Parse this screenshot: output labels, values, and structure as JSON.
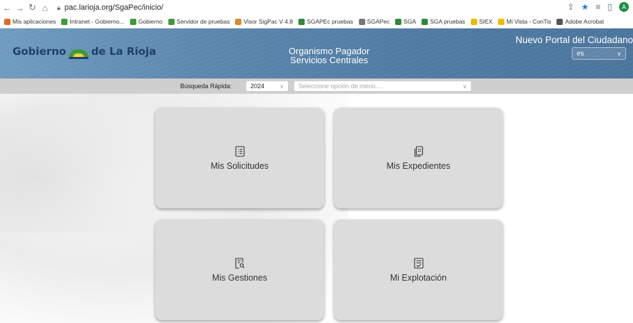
{
  "browser": {
    "url": "pac.larioja.org/SgaPec/inicio/",
    "profile_initial": "A"
  },
  "bookmarks": [
    {
      "label": "Mis aplicaciones",
      "color": "#e06a2a"
    },
    {
      "label": "Intranet - Gobierno...",
      "color": "#3f9a3a"
    },
    {
      "label": "Gobierno",
      "color": "#3f9a3a"
    },
    {
      "label": "Servidor de pruebas",
      "color": "#3f9a3a"
    },
    {
      "label": "Visor SigPac V 4.8",
      "color": "#d98a2b"
    },
    {
      "label": "SGAPEc pruebas",
      "color": "#2d8a3a"
    },
    {
      "label": "SGAPec",
      "color": "#777777"
    },
    {
      "label": "SGA",
      "color": "#2d8a3a"
    },
    {
      "label": "SGA pruebas",
      "color": "#2d8a3a"
    },
    {
      "label": "SIEX",
      "color": "#f2b705"
    },
    {
      "label": "Mi Vista - ConTis",
      "color": "#f2b705"
    },
    {
      "label": "Adobe Acrobat",
      "color": "#555555"
    }
  ],
  "header": {
    "logo_text_1": "Gobierno",
    "logo_text_2": "de La Rioja",
    "org_line1": "Organismo Pagador",
    "org_line2": "Servicios Centrales",
    "portal_title": "Nuevo Portal del Ciudadano",
    "language": "es"
  },
  "search": {
    "label": "Búsqueda Rápida:",
    "year": "2024",
    "menu_placeholder": "Seleccione opción de menú...."
  },
  "tiles": [
    {
      "label": "Mis Solicitudes",
      "icon": "list-icon"
    },
    {
      "label": "Mis Expedientes",
      "icon": "documents-icon"
    },
    {
      "label": "Mis Gestiones",
      "icon": "document-search-icon"
    },
    {
      "label": "Mi Explotación",
      "icon": "document-check-icon"
    }
  ]
}
